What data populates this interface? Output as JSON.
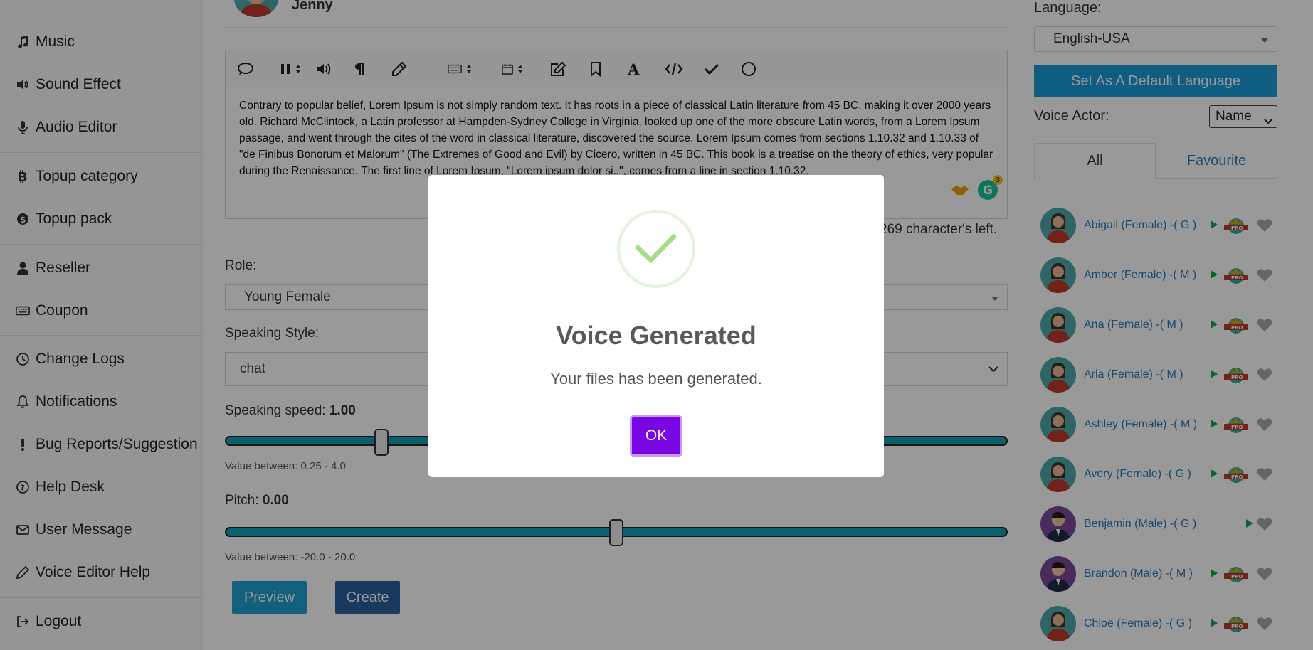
{
  "sidebar": {
    "items": [
      {
        "label": "Music",
        "icon": "music-icon"
      },
      {
        "label": "Sound Effect",
        "icon": "volume-icon"
      },
      {
        "label": "Audio Editor",
        "icon": "microphone-icon"
      },
      {
        "label": "Topup category",
        "icon": "bitcoin-icon"
      },
      {
        "label": "Topup pack",
        "icon": "dollar-coin-icon"
      },
      {
        "label": "Reseller",
        "icon": "user-icon"
      },
      {
        "label": "Coupon",
        "icon": "keyboard-icon"
      },
      {
        "label": "Change Logs",
        "icon": "clock-icon"
      },
      {
        "label": "Notifications",
        "icon": "bell-icon"
      },
      {
        "label": "Bug Reports/Suggestion",
        "icon": "exclamation-icon"
      },
      {
        "label": "Help Desk",
        "icon": "question-circle-icon"
      },
      {
        "label": "User Message",
        "icon": "envelope-icon"
      },
      {
        "label": "Voice Editor Help",
        "icon": "pencil-icon"
      },
      {
        "label": "Logout",
        "icon": "sign-out-icon"
      }
    ]
  },
  "user": {
    "name": "Jenny"
  },
  "editor": {
    "text": "Contrary to popular belief, Lorem Ipsum is not simply random text. It has roots in a piece of classical Latin literature from 45 BC, making it over 2000 years old. Richard McClintock, a Latin professor at Hampden-Sydney College in Virginia, looked up one of the more obscure Latin words, from a Lorem Ipsum passage, and went through the cites of the word in classical literature, discovered the source. Lorem Ipsum comes from sections 1.10.32 and 1.10.33 of \"de Finibus Bonorum et Malorum\" (The Extremes of Good and Evil) by Cicero, written in 45 BC. This book is a treatise on the theory of ethics, very popular during the Renaissance. The first line of Lorem Ipsum, \"Lorem ipsum dolor si..\", comes from a line in section 1.10.32.",
    "chars_left": "269 character's left.",
    "grammarly_badge": "3"
  },
  "role": {
    "label": "Role:",
    "value": "Young Female"
  },
  "style": {
    "label": "Speaking Style:",
    "value": "chat"
  },
  "speed": {
    "label": "Speaking speed:",
    "value": "1.00",
    "hint": "Value between: 0.25 - 4.0",
    "fraction": 0.2
  },
  "pitch": {
    "label": "Pitch:",
    "value": "0.00",
    "hint": "Value between: -20.0 - 20.0",
    "fraction": 0.5
  },
  "buttons": {
    "preview": "Preview",
    "create": "Create"
  },
  "right": {
    "language_label": "Language:",
    "language_value": "English-USA",
    "default_btn": "Set As A Default Language",
    "voice_actor_label": "Voice Actor:",
    "voice_actor_select": "Name",
    "tab_all": "All",
    "tab_fav": "Favourite",
    "actors": [
      {
        "name": "Abigail (Female) -( G )",
        "gender": "female",
        "pro": true
      },
      {
        "name": "Amber (Female) -( M )",
        "gender": "female",
        "pro": true
      },
      {
        "name": "Ana (Female) -( M )",
        "gender": "female",
        "pro": true
      },
      {
        "name": "Aria (Female) -( M )",
        "gender": "female",
        "pro": true
      },
      {
        "name": "Ashley (Female) -( M )",
        "gender": "female",
        "pro": true
      },
      {
        "name": "Avery (Female) -( G )",
        "gender": "female",
        "pro": true
      },
      {
        "name": "Benjamin (Male) -( G )",
        "gender": "male",
        "pro": false
      },
      {
        "name": "Brandon (Male) -( M )",
        "gender": "male",
        "pro": true
      },
      {
        "name": "Chloe (Female) -( G )",
        "gender": "female",
        "pro": true
      }
    ]
  },
  "modal": {
    "title": "Voice Generated",
    "text": "Your files has been generated.",
    "ok": "OK"
  },
  "colors": {
    "accent": "#1a9bd7",
    "slider": "#12a0b4",
    "ok": "#7a06e4",
    "create": "#2a5f9e",
    "link": "#2a7ab8"
  }
}
